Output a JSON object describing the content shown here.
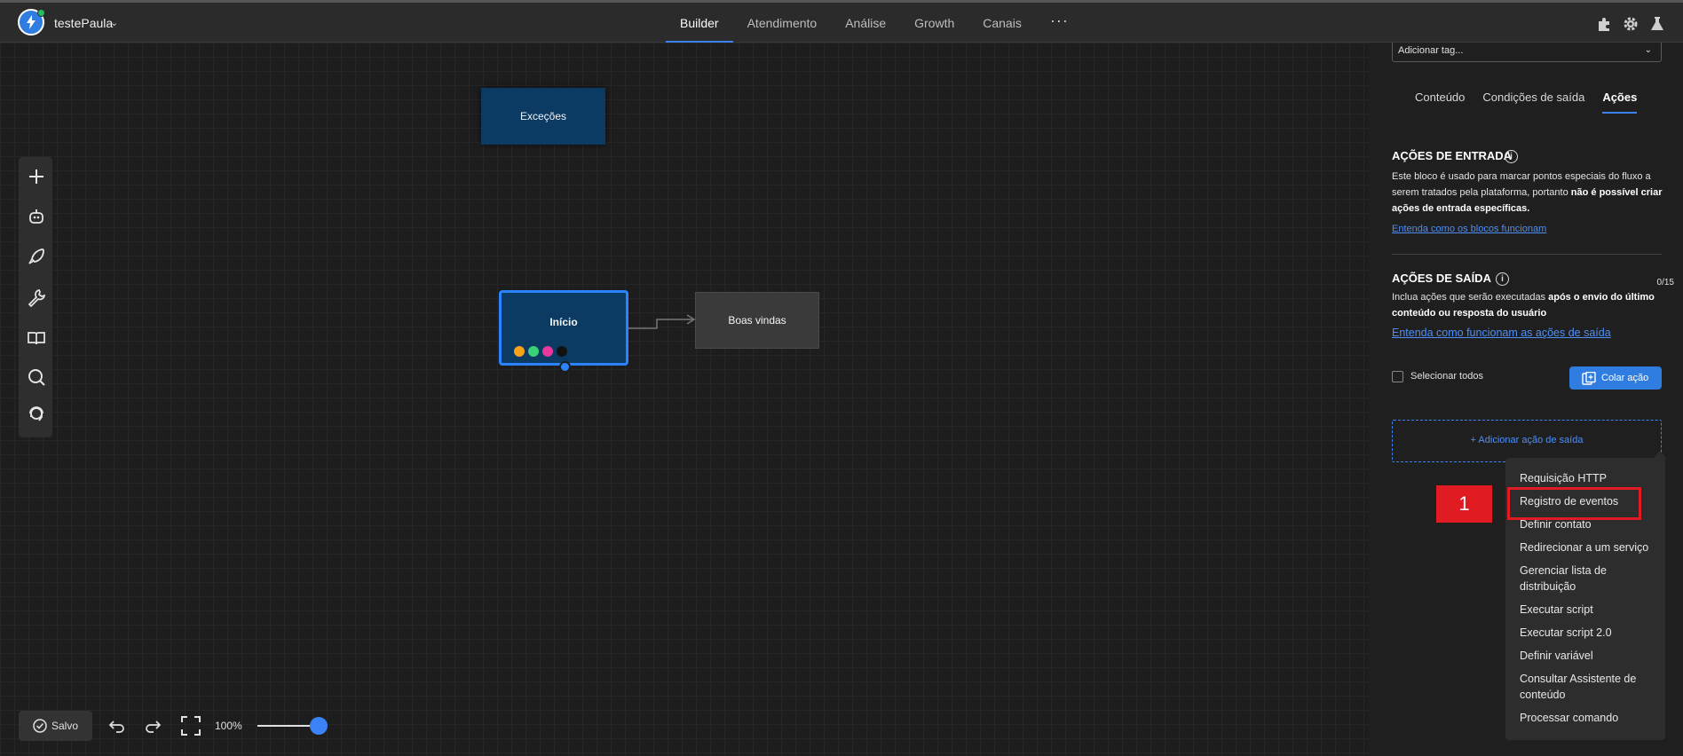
{
  "app": {
    "bot_name": "testePaula",
    "nav": [
      "Builder",
      "Atendimento",
      "Análise",
      "Growth",
      "Canais"
    ],
    "nav_active": "Builder"
  },
  "canvas": {
    "nodes": {
      "excecoes": "Exceções",
      "inicio": "Início",
      "boas_vindas": "Boas vindas"
    },
    "tag_colors": [
      "#f7a21b",
      "#3ccf7a",
      "#e8399b",
      "#111111"
    ],
    "bottom": {
      "saved_label": "Salvo",
      "zoom": "100%"
    }
  },
  "panel": {
    "tag_placeholder": "Adicionar tag...",
    "tabs": [
      "Conteúdo",
      "Condições de saída",
      "Ações"
    ],
    "active_tab": "Ações",
    "entrada": {
      "title": "AÇÕES DE ENTRADA",
      "text_1": "Este bloco é usado para marcar pontos especiais do fluxo a serem tratados pela plataforma, portanto ",
      "text_bold": "não é possível criar ações de entrada específicas.",
      "link": "Entenda como os blocos funcionam"
    },
    "saida": {
      "title": "AÇÕES DE SAÍDA",
      "counter": "0/15",
      "text_1": "Inclua ações que serão executadas ",
      "text_bold": "após o envio do último conteúdo ou resposta do usuário",
      "link": "Entenda como funcionam as ações de saída",
      "select_all": "Selecionar todos",
      "paste_button": "Colar ação",
      "add_button": "+ Adicionar ação de saída"
    }
  },
  "menu": {
    "items": [
      "Requisição HTTP",
      "Registro de eventos",
      "Definir contato",
      "Redirecionar a um serviço",
      "Gerenciar lista de distribuição",
      "Executar script",
      "Executar script 2.0",
      "Definir variável",
      "Consultar Assistente de conteúdo",
      "Processar comando"
    ],
    "highlighted": "Registro de eventos"
  },
  "annotation": {
    "marker": "1",
    "color": "#e01b22"
  },
  "colors": {
    "accent": "#3b82f6",
    "node_blue": "#0b3a63"
  }
}
